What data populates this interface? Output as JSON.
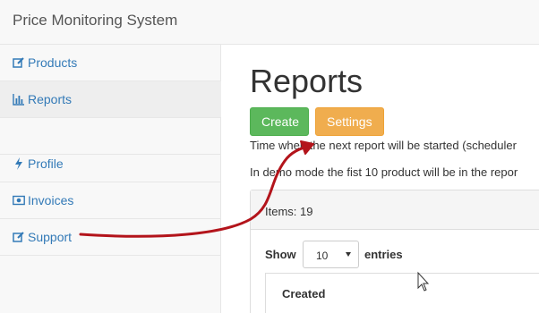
{
  "app": {
    "title": "Price Monitoring System"
  },
  "sidebar": {
    "items": [
      {
        "label": "Products",
        "icon": "edit-icon"
      },
      {
        "label": "Reports",
        "icon": "bar-chart-icon"
      },
      {
        "label": "Profile",
        "icon": "lightning-icon"
      },
      {
        "label": "Invoices",
        "icon": "money-icon"
      },
      {
        "label": "Support",
        "icon": "edit-icon"
      }
    ]
  },
  "page": {
    "title": "Reports",
    "create_label": "Create",
    "settings_label": "Settings",
    "info_scheduler": "Time when the next report will be started (scheduler",
    "info_demo": "In demo mode the fist 10 product will be in the repor",
    "items_count": "Items: 19",
    "show_label": "Show",
    "page_size": "10",
    "entries_label": "entries",
    "column_created": "Created"
  },
  "colors": {
    "link": "#337ab7",
    "create": "#5cb85c",
    "settings": "#f0ad4e",
    "arrow": "#b3141b"
  }
}
